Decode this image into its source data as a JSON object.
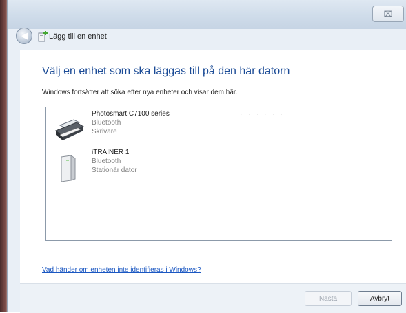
{
  "window": {
    "close_label": "⌧"
  },
  "nav": {
    "back_icon": "back-arrow-icon",
    "title": "Lägg till en enhet"
  },
  "main": {
    "heading": "Välj en enhet som ska läggas till på den här datorn",
    "subtext": "Windows fortsätter att söka efter nya enheter och visar dem här.",
    "devices": [
      {
        "name": "Photosmart C7100 series",
        "connection": "Bluetooth",
        "category": "Skrivare",
        "icon": "printer-icon"
      },
      {
        "name": "iTRAINER 1",
        "connection": "Bluetooth",
        "category": "Stationär dator",
        "icon": "desktop-tower-icon"
      }
    ],
    "help_link": "Vad händer om enheten inte identifieras i Windows?"
  },
  "footer": {
    "next_label": "Nästa",
    "cancel_label": "Avbryt"
  }
}
